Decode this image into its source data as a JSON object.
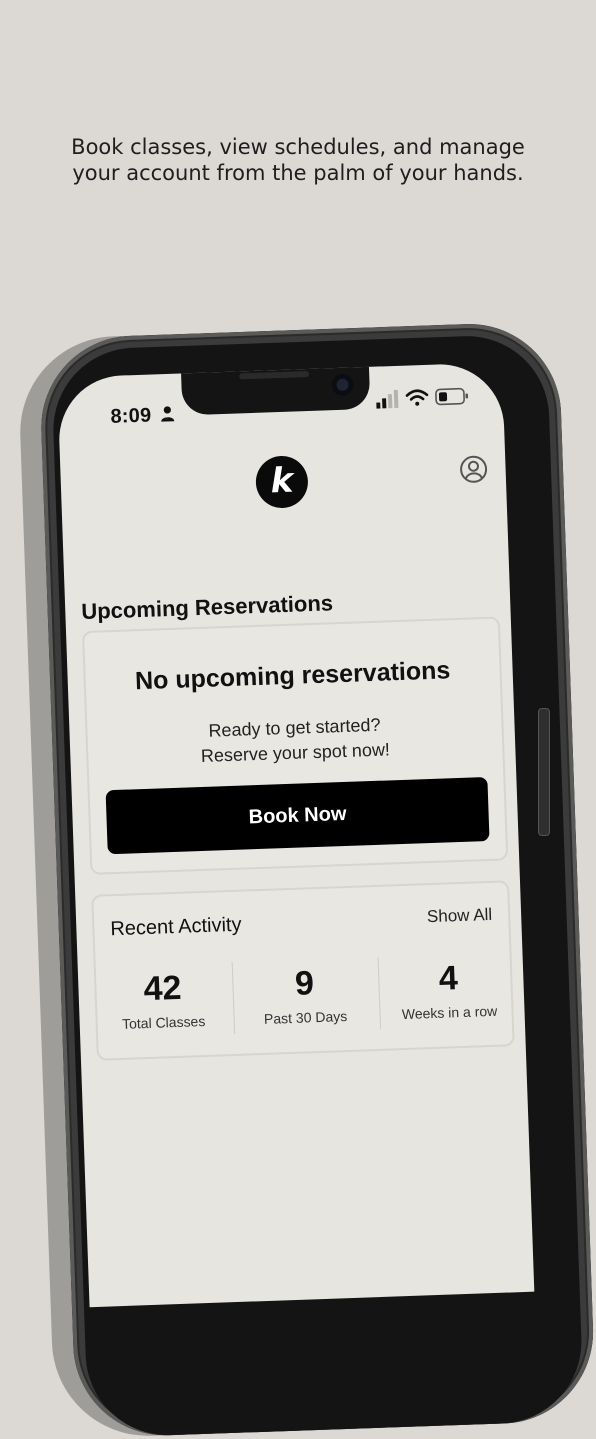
{
  "tagline": {
    "line1": "Book classes, view schedules, and manage",
    "line2": "your account from the palm of your hands."
  },
  "status_bar": {
    "time": "8:09"
  },
  "header": {
    "logo_letter": "k",
    "profile_icon": "person-circle-icon"
  },
  "reservations": {
    "section_title": "Upcoming Reservations",
    "empty_title": "No upcoming reservations",
    "empty_line1": "Ready to get started?",
    "empty_line2": "Reserve your spot now!",
    "button_label": "Book Now"
  },
  "activity": {
    "title": "Recent Activity",
    "show_all": "Show All",
    "stats": [
      {
        "value": "42",
        "label": "Total Classes"
      },
      {
        "value": "9",
        "label": "Past 30 Days"
      },
      {
        "value": "4",
        "label": "Weeks in a row"
      }
    ]
  },
  "colors": {
    "background": "#dcd8d4",
    "screen": "#e7e5e0",
    "button": "#000000"
  }
}
